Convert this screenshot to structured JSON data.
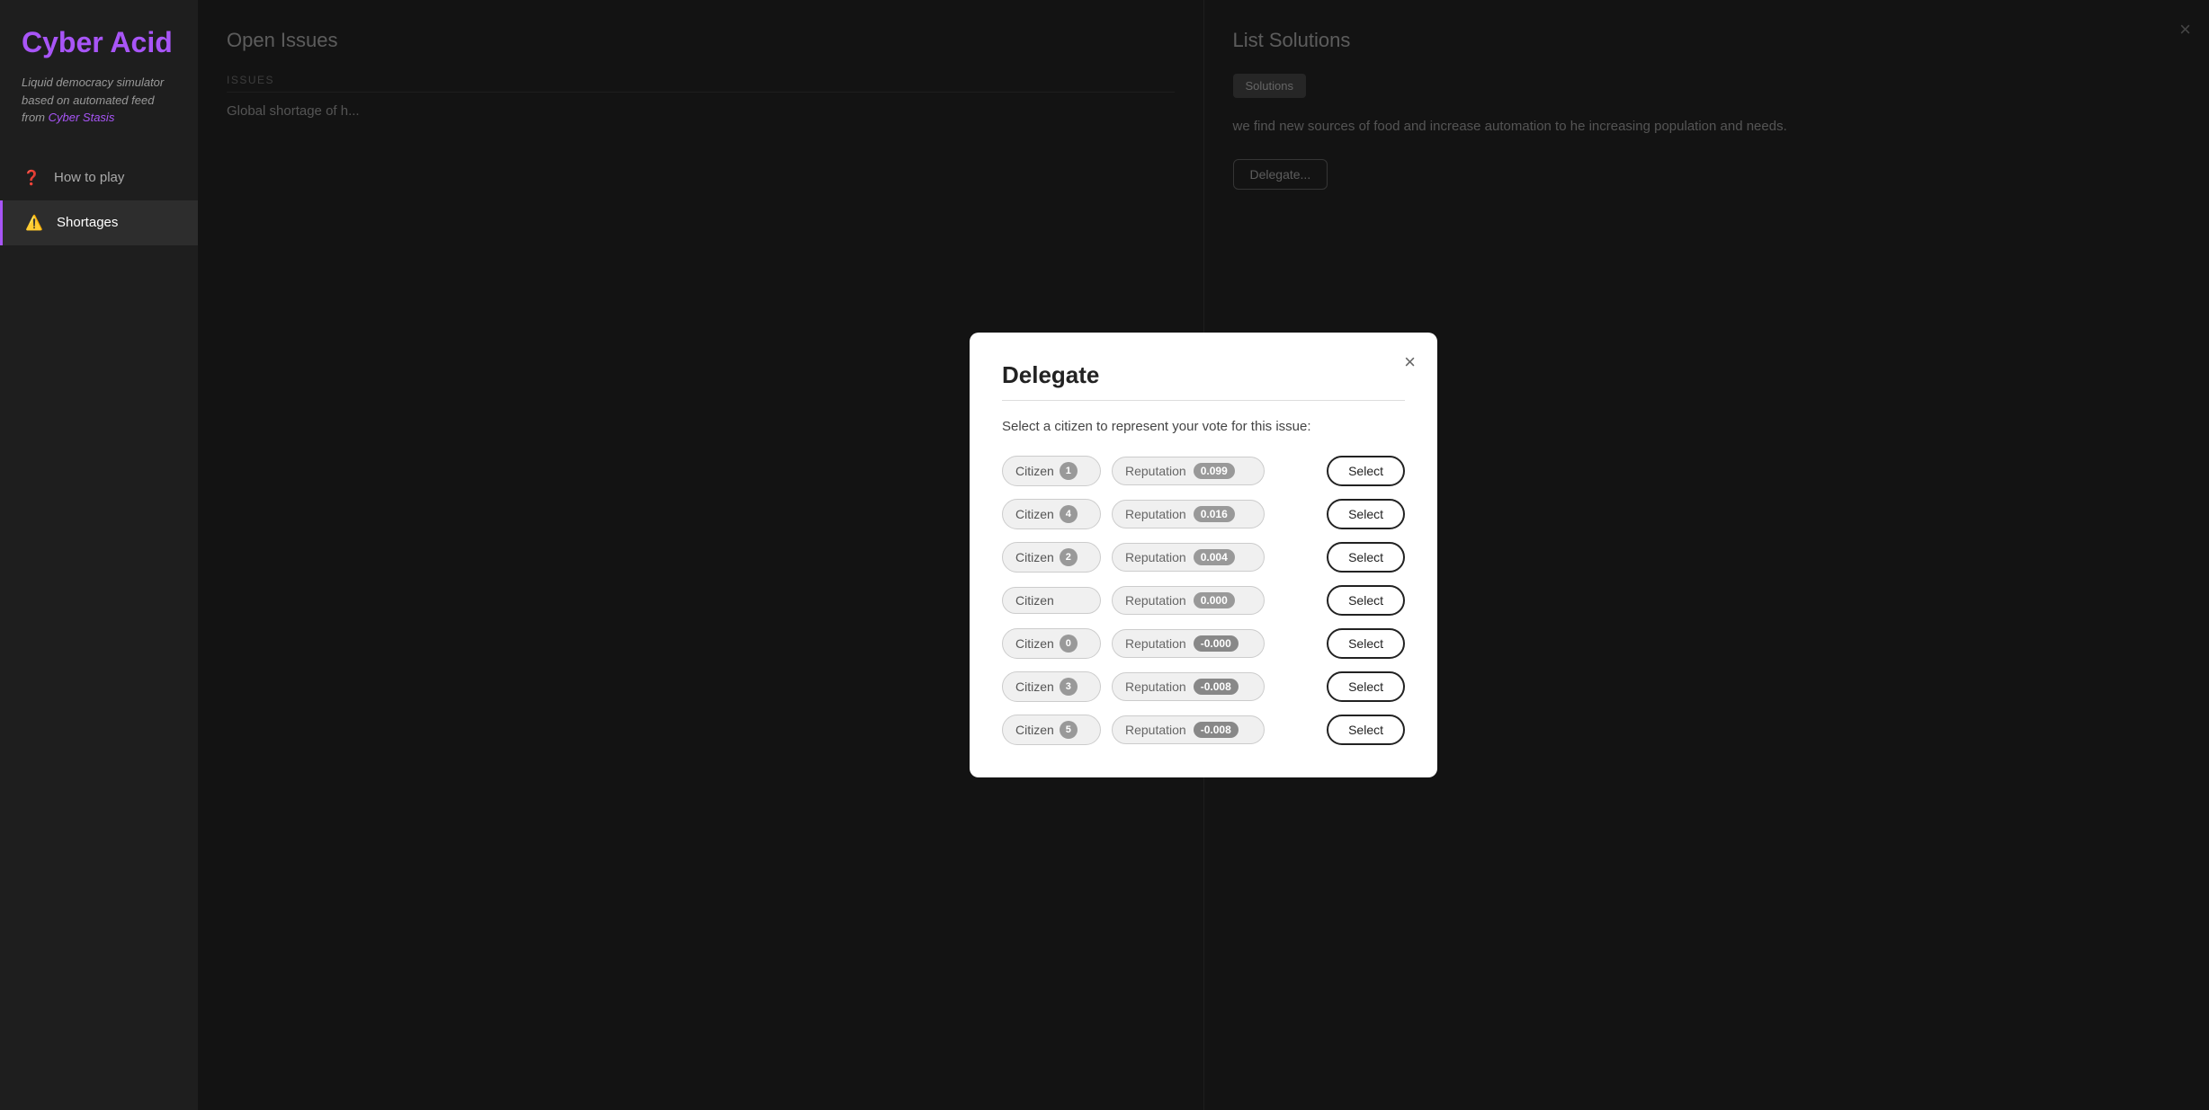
{
  "sidebar": {
    "title": "Cyber Acid",
    "subtitle_plain": "Liquid democracy simulator based on automated feed from ",
    "subtitle_link": "Cyber Stasis",
    "nav_items": [
      {
        "id": "how-to-play",
        "label": "How to play",
        "icon": "❓",
        "active": false
      },
      {
        "id": "shortages",
        "label": "Shortages",
        "icon": "⚠️",
        "active": true
      }
    ]
  },
  "open_issues": {
    "title": "Open Issues",
    "section_label": "ISSUES",
    "issue_text": "Global shortage of h..."
  },
  "list_solutions": {
    "title": "List Solutions",
    "tab_label": "Solutions",
    "solution_body": "we find new sources of food and increase automation to he increasing population and needs.",
    "delegate_button": "Delegate..."
  },
  "modal": {
    "title": "Delegate",
    "close_label": "×",
    "subtitle": "Select a citizen to represent your vote for this issue:",
    "citizens": [
      {
        "name": "Citizen",
        "badge": "1",
        "reputation_label": "Reputation",
        "reputation_value": "0.099",
        "negative": false
      },
      {
        "name": "Citizen",
        "badge": "4",
        "reputation_label": "Reputation",
        "reputation_value": "0.016",
        "negative": false
      },
      {
        "name": "Citizen",
        "badge": "2",
        "reputation_label": "Reputation",
        "reputation_value": "0.004",
        "negative": false
      },
      {
        "name": "Citizen",
        "badge": "",
        "reputation_label": "Reputation",
        "reputation_value": "0.000",
        "negative": false
      },
      {
        "name": "Citizen",
        "badge": "0",
        "reputation_label": "Reputation",
        "reputation_value": "-0.000",
        "negative": true
      },
      {
        "name": "Citizen",
        "badge": "3",
        "reputation_label": "Reputation",
        "reputation_value": "-0.008",
        "negative": true
      },
      {
        "name": "Citizen",
        "badge": "5",
        "reputation_label": "Reputation",
        "reputation_value": "-0.008",
        "negative": true
      }
    ],
    "select_label": "Select"
  }
}
